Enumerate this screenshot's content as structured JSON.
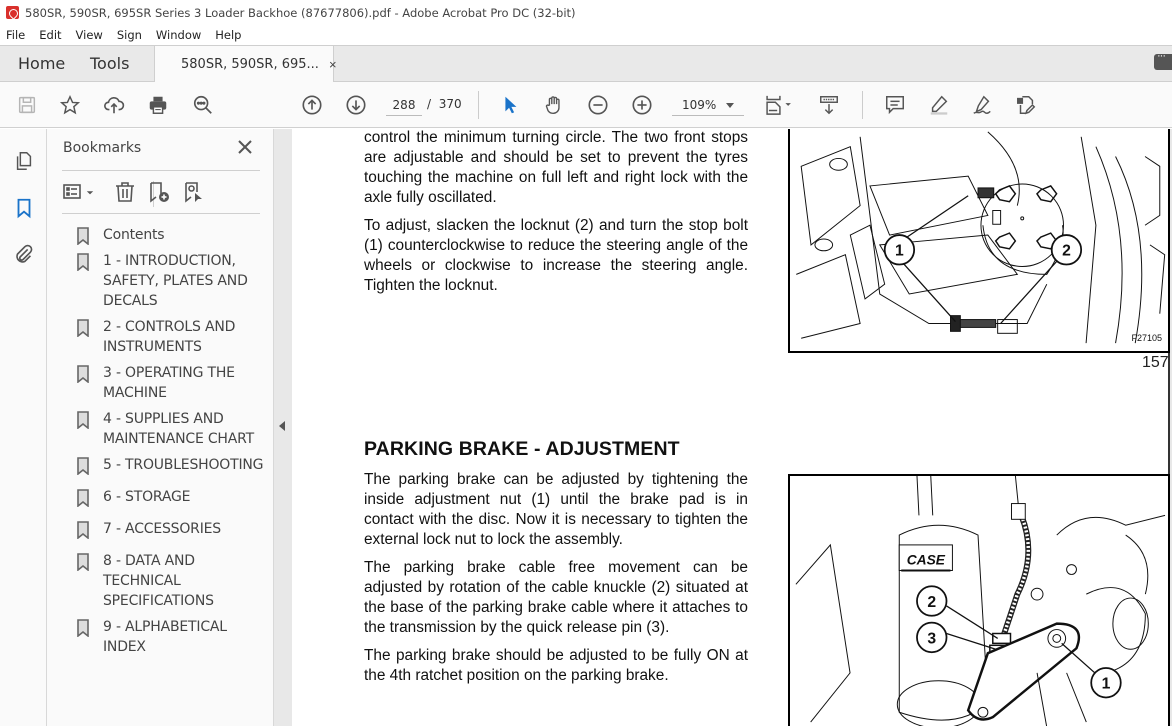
{
  "window": {
    "title": "580SR, 590SR, 695SR Series 3 Loader Backhoe (87677806).pdf - Adobe Acrobat Pro DC (32-bit)",
    "app_icon": "acrobat-icon"
  },
  "menu": [
    "File",
    "Edit",
    "View",
    "Sign",
    "Window",
    "Help"
  ],
  "tabs": {
    "home": "Home",
    "tools": "Tools",
    "document": "580SR, 590SR, 695...",
    "close": "×"
  },
  "toolbar": {
    "left_icons": [
      "save-icon",
      "star-icon",
      "cloud-upload-icon",
      "print-icon",
      "search-zoom-icon"
    ],
    "page_current": "288",
    "page_separator": "/",
    "page_total": "370",
    "zoom_level": "109%",
    "right_icons": [
      "select-cursor-icon",
      "hand-icon",
      "zoom-out-icon",
      "zoom-in-icon",
      "fit-page-icon",
      "scroll-mode-icon",
      "comment-icon",
      "highlight-icon",
      "sign-icon",
      "edit-pdf-icon"
    ],
    "accent_color": "#1a73c9"
  },
  "sidebar": {
    "panel_title": "Bookmarks",
    "rail_icons": [
      "pages-icon",
      "bookmark-icon",
      "attachment-icon"
    ],
    "panel_tools": [
      "options-menu-icon",
      "delete-icon",
      "new-bookmark-icon",
      "bookmark-from-selection-icon"
    ],
    "bookmarks": [
      {
        "label": "Contents"
      },
      {
        "label": "1 - INTRODUCTION, SAFETY, PLATES AND DECALS"
      },
      {
        "label": "2 - CONTROLS AND INSTRUMENTS"
      },
      {
        "label": "3 - OPERATING THE MACHINE"
      },
      {
        "label": "4 - SUPPLIES AND MAINTENANCE CHART"
      },
      {
        "label": "5 - TROUBLESHOOTING"
      },
      {
        "label": "6 - STORAGE"
      },
      {
        "label": "7 - ACCESSORIES"
      },
      {
        "label": "8 - DATA AND TECHNICAL SPECIFICATIONS"
      },
      {
        "label": "9 - ALPHABETICAL INDEX"
      }
    ]
  },
  "document": {
    "para1": "control the minimum turning circle. The two front stops are adjustable and should be set to prevent the tyres touching the machine on full left and right lock with the axle fully oscillated.",
    "para2": "To adjust, slacken the locknut (2) and turn the stop bolt (1) counterclockwise to reduce the steering angle of the wheels or clockwise to increase the steering angle. Tighten the locknut.",
    "page_number": "157",
    "figure1": {
      "code": "F27105",
      "callouts": [
        "1",
        "2"
      ]
    },
    "heading": "PARKING BRAKE - ADJUSTMENT",
    "para3": "The parking brake can be adjusted by tightening the inside adjustment nut (1) until the brake pad is in contact with the disc. Now it is necessary to tighten the external lock nut to lock the assembly.",
    "para4": "The parking brake cable free movement can be adjusted by rotation of the cable knuckle (2) situated at the base of the parking brake cable where it attaches to the transmission by the quick release pin (3).",
    "para5": "The parking brake should be adjusted to be fully ON at the 4th ratchet position on the parking brake.",
    "figure2": {
      "brand_label": "CASE",
      "callouts": [
        "2",
        "3",
        "1"
      ]
    }
  }
}
